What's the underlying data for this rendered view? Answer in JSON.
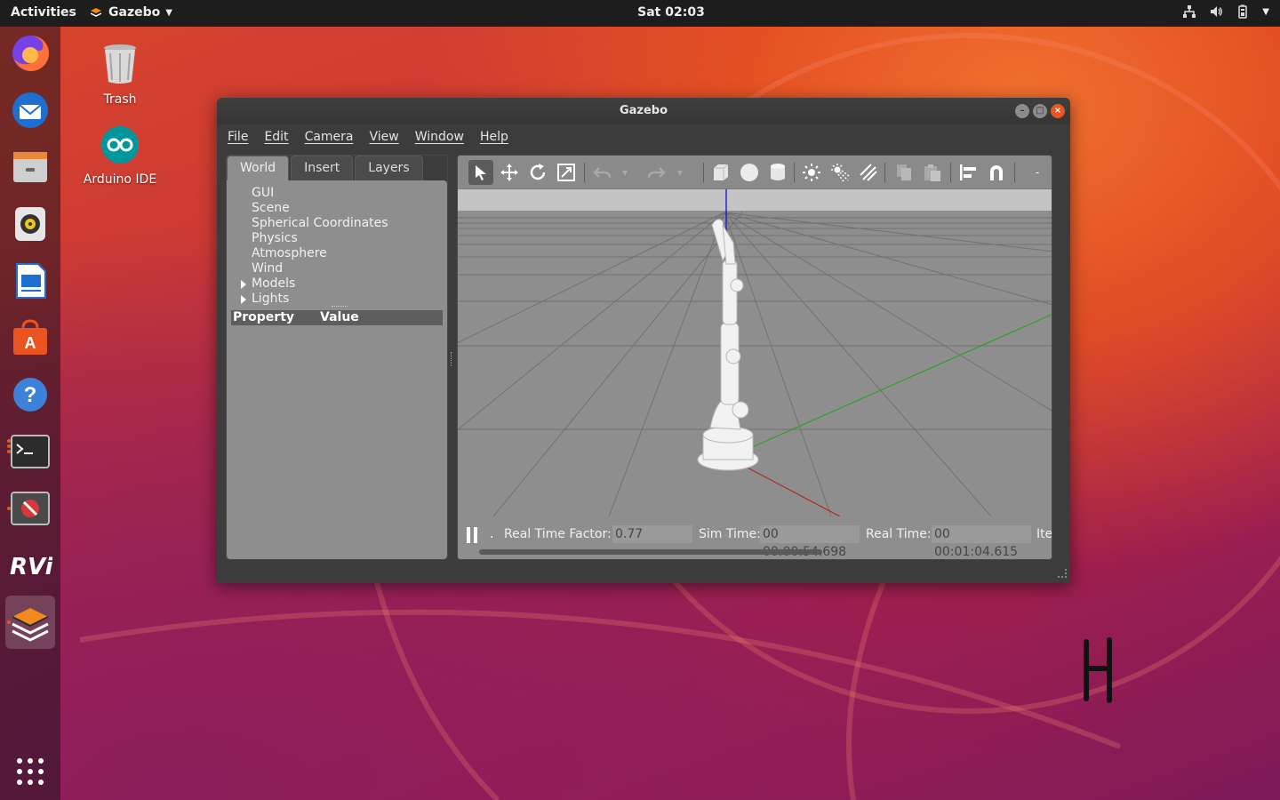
{
  "topbar": {
    "activities": "Activities",
    "app_menu": "Gazebo",
    "clock": "Sat 02:03"
  },
  "desktop": {
    "icons": [
      {
        "label": "Trash"
      },
      {
        "label": "Arduino IDE"
      }
    ]
  },
  "dock": {
    "apps": [
      "firefox-icon",
      "thunderbird-icon",
      "files-icon",
      "rhythmbox-icon",
      "libreoffice-writer-icon",
      "software-center-icon",
      "help-icon",
      "terminal-icon",
      "rqt-icon",
      "rviz-icon",
      "gazebo-icon"
    ],
    "rviz_label": "RViz"
  },
  "window": {
    "title": "Gazebo",
    "menu": [
      "File",
      "Edit",
      "Camera",
      "View",
      "Window",
      "Help"
    ],
    "tabs": [
      "World",
      "Insert",
      "Layers"
    ],
    "tree": [
      "GUI",
      "Scene",
      "Spherical Coordinates",
      "Physics",
      "Atmosphere",
      "Wind",
      "Models",
      "Lights"
    ],
    "property_header": {
      "property": "Property",
      "value": "Value"
    },
    "status": {
      "rtf_label": "Real Time Factor:",
      "rtf_value": "0.77",
      "sim_label": "Sim Time:",
      "sim_value": "00 00:00:54.698",
      "real_label": "Real Time:",
      "real_value": "00 00:01:04.615",
      "iter_label": "Ite"
    }
  },
  "colors": {
    "accent": "#e95420",
    "panel_gray": "#8e8e8e",
    "window_dark": "#3c3c3c"
  }
}
